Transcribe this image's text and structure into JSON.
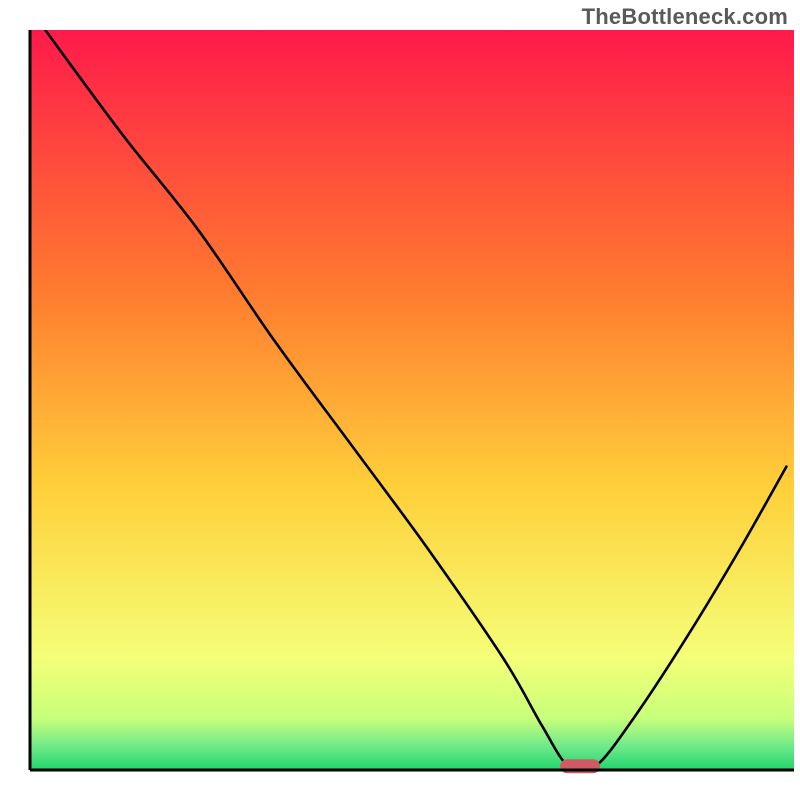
{
  "watermark": "TheBottleneck.com",
  "chart_data": {
    "type": "line",
    "title": "",
    "xlabel": "",
    "ylabel": "",
    "xlim": [
      0,
      100
    ],
    "ylim": [
      0,
      100
    ],
    "grid": false,
    "legend": false,
    "series": [
      {
        "name": "bottleneck-curve",
        "x": [
          2,
          12,
          22,
          32,
          42,
          52,
          62,
          67,
          70.5,
          74,
          79,
          86,
          93,
          99
        ],
        "values": [
          100,
          86,
          73,
          58,
          44,
          30,
          15,
          6,
          0.5,
          0.5,
          7,
          18,
          30,
          41
        ]
      }
    ],
    "marker": {
      "name": "optimal-point",
      "x": 72,
      "y": 0.5,
      "color": "#d05a63"
    },
    "background": {
      "gradient_top": "#ff1a4b",
      "gradient_mid": "#ffd03a",
      "gradient_low": "#f4ff78",
      "gradient_bottom": "#1fd66a"
    },
    "axis_color": "#000000",
    "curve_color": "#000000"
  }
}
